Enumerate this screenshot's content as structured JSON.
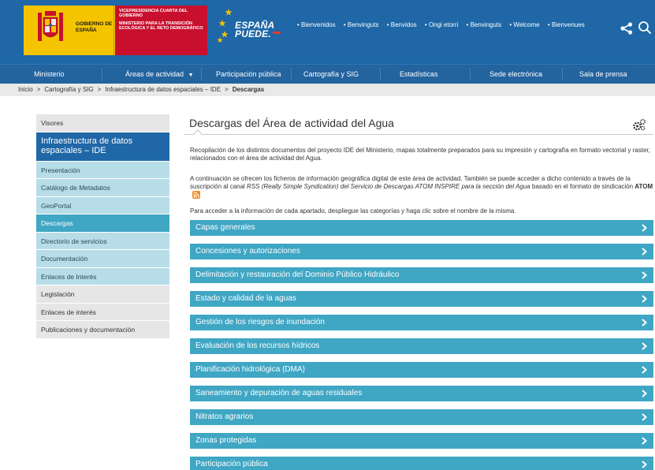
{
  "header": {
    "gobierno_label": "GOBIERNO DE ESPAÑA",
    "vice_line1": "VICEPRESIDENCIA CUARTA DEL GOBIERNO",
    "vice_line2": "MINISTERIO PARA LA TRANSICIÓN ECOLÓGICA Y EL RETO DEMOGRÁFICO",
    "brand_line1": "ESPAÑA",
    "brand_line2": "PUEDE.",
    "welcome": [
      "Bienvenidos",
      "Benvinguts",
      "Benvidos",
      "Ongi etorri",
      "Benvinguts",
      "Welcome",
      "Bienvenues"
    ],
    "colors": {
      "header_bg": "#1f67a6",
      "gov_yellow": "#f5c400",
      "gov_red": "#c8102e"
    }
  },
  "nav": {
    "items": [
      "Ministerio",
      "Áreas de actividad",
      "Participación pública",
      "Cartografía y SIG",
      "Estadísticas",
      "Sede electrónica",
      "Sala de prensa"
    ]
  },
  "breadcrumb": {
    "items": [
      "Inicio",
      "Cartografía y SIG",
      "Infraestructura de datos espaciales – IDE"
    ],
    "current": "Descargas",
    "separator": ">"
  },
  "sidebar": {
    "visores": "Visores",
    "header": "Infraestructura de datos espaciales – IDE",
    "sub_items": [
      "Presentación",
      "Catálogo de Metadatos",
      "GeoPortal"
    ],
    "active": "Descargas",
    "sub_items2": [
      "Directorio de servicios",
      "Documentación",
      "Enlaces de Interés"
    ],
    "plain_items": [
      "Legislación",
      "Enlaces de interés",
      "Publicaciones y documentación"
    ]
  },
  "main": {
    "title": "Descargas del Área de actividad del Agua",
    "p1": "Recopilación de los distintos documentos del proyecto IDE del Ministerio, mapas totalmente preparados para su impresión y cartografía en formato vectorial y raster, relacionados con el área de actividad del Agua.",
    "p2_a": "A continuación se ofrecen los ficheros de información geográfica digital de este área de actividad. También se puede acceder a dicho contenido a través de la suscripción al canal ",
    "p2_b": "RSS (Really Simple Syndication) del Servicio de Descargas ATOM INSPIRE para la sección del Agua",
    "p2_c": " basado en el formato de sindicación ",
    "p2_d": "ATOM",
    "p3": "Para acceder a la información de cada apartado, despliegue las categorías y haga clic sobre el nombre de la misma.",
    "accordion": [
      "Capas generales",
      "Concesiones y autorizaciones",
      "Delimitación y restauración del Dominio Público Hidráulico",
      "Estado y calidad de la aguas",
      "Gestión de los riesgos de inundación",
      "Evaluación de los recursos hídricos",
      "Planificación hidrológica (DMA)",
      "Saneamiento y depuración de aguas residuales",
      "Nitratos agrarios",
      "Zonas protegidas",
      "Participación pública"
    ],
    "colors": {
      "accordion_bg": "#3fa6c4"
    }
  }
}
